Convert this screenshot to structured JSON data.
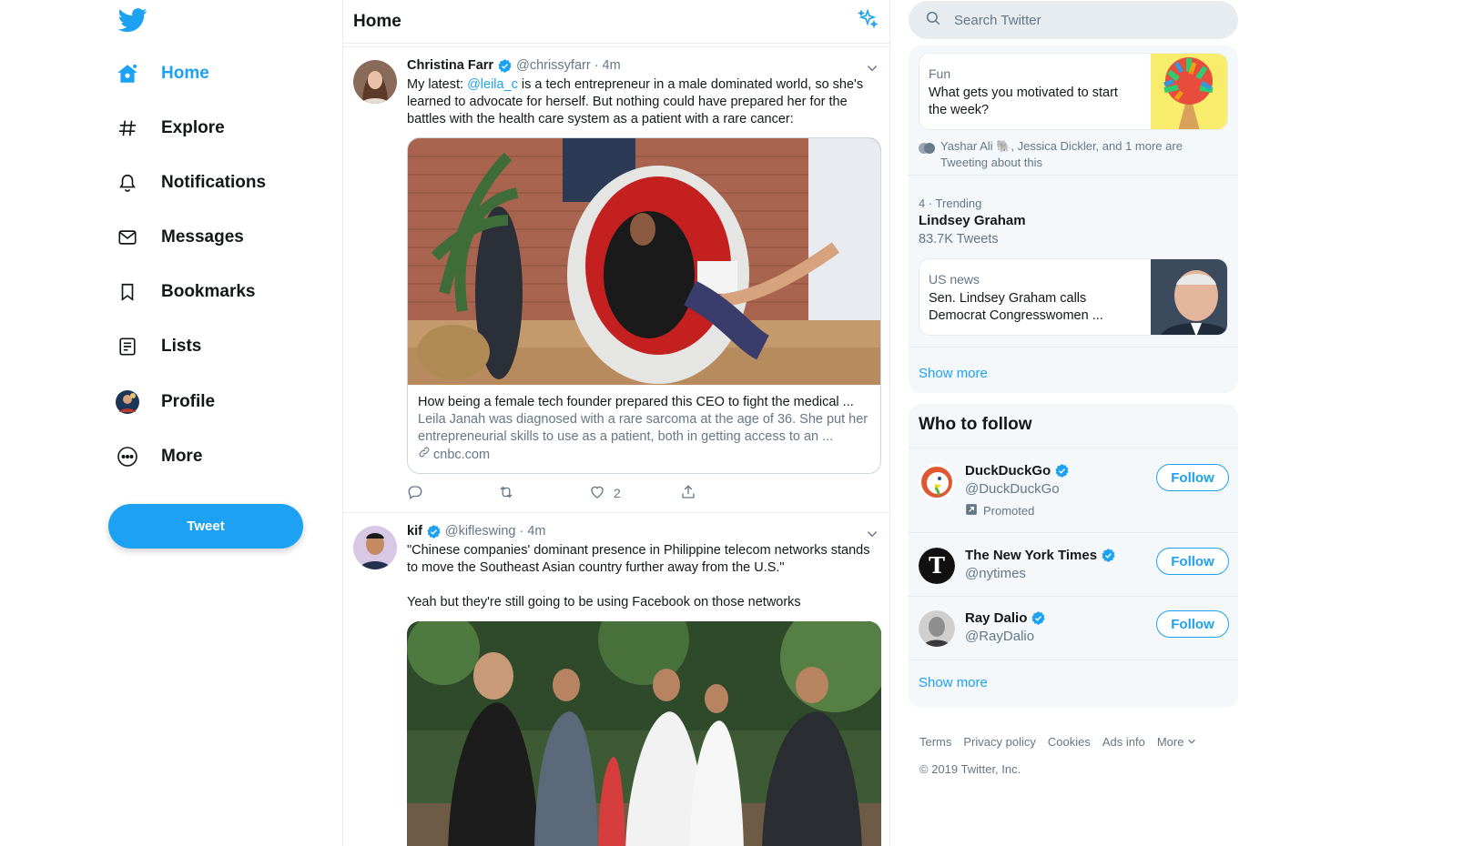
{
  "nav": {
    "items": [
      {
        "label": "Home",
        "icon": "home-icon",
        "active": true
      },
      {
        "label": "Explore",
        "icon": "hashtag-icon"
      },
      {
        "label": "Notifications",
        "icon": "bell-icon"
      },
      {
        "label": "Messages",
        "icon": "envelope-icon"
      },
      {
        "label": "Bookmarks",
        "icon": "bookmark-icon"
      },
      {
        "label": "Lists",
        "icon": "list-icon"
      },
      {
        "label": "Profile",
        "icon": "profile-avatar"
      },
      {
        "label": "More",
        "icon": "more-icon"
      }
    ],
    "tweet_label": "Tweet"
  },
  "feed": {
    "title": "Home",
    "tweets": [
      {
        "name": "Christina Farr",
        "handle": "@chrissyfarr",
        "dot": "·",
        "time": "4m",
        "text_prefix": "My latest: ",
        "mention": "@leila_c",
        "text_suffix": " is a tech entrepreneur in a male dominated world, so she's learned to advocate for herself. But nothing could have prepared her for the battles with the health care system as a patient with a rare cancer:",
        "card": {
          "title": "How being a female tech founder prepared this CEO to fight the medical ...",
          "description": "Leila Janah was diagnosed with a rare sarcoma at the age of 36. She put her entrepreneurial skills to use as a patient, both in getting access to an ...",
          "link": "cnbc.com"
        },
        "likes": "2"
      },
      {
        "name": "kif",
        "handle": "@kifleswing",
        "dot": "·",
        "time": "4m",
        "text": "\"Chinese companies' dominant presence in Philippine telecom networks stands to move the Southeast Asian country further away from the U.S.\"",
        "text2": "Yeah but they're still going to be using Facebook on those networks"
      }
    ]
  },
  "search": {
    "placeholder": "Search Twitter"
  },
  "trends": {
    "moment": {
      "category": "Fun",
      "title": "What gets you motivated to start the week?"
    },
    "social": "Yashar Ali 🐘, Jessica Dickler, and 1 more are Tweeting about this",
    "trend_meta": "4 · Trending",
    "trend_name": "Lindsey Graham",
    "trend_count": "83.7K Tweets",
    "news": {
      "category": "US news",
      "title": "Sen. Lindsey Graham calls Democrat Congresswomen ..."
    },
    "show_more": "Show more"
  },
  "who_to_follow": {
    "title": "Who to follow",
    "accounts": [
      {
        "name": "DuckDuckGo",
        "handle": "@DuckDuckGo",
        "promoted": "Promoted",
        "button": "Follow"
      },
      {
        "name": "The New York Times",
        "handle": "@nytimes",
        "button": "Follow"
      },
      {
        "name": "Ray Dalio",
        "handle": "@RayDalio",
        "button": "Follow"
      }
    ],
    "show_more": "Show more"
  },
  "footer": {
    "links": [
      "Terms",
      "Privacy policy",
      "Cookies",
      "Ads info",
      "More"
    ],
    "copyright": "© 2019 Twitter, Inc."
  },
  "colors": {
    "accent": "#1da1f2",
    "text": "#14171a",
    "secondary": "#657786",
    "panel": "#f5f8fa"
  }
}
